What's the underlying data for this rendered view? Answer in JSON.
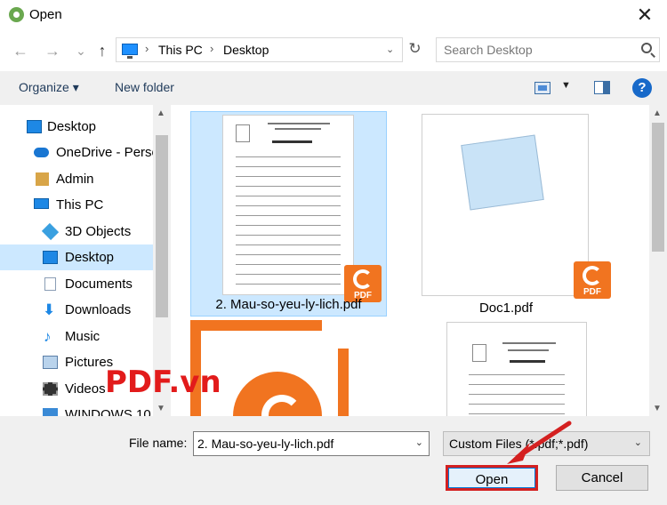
{
  "window": {
    "title": "Open",
    "close_glyph": "✕"
  },
  "nav_buttons": {
    "back": "←",
    "forward": "→",
    "recent": "⌄",
    "up": "↑"
  },
  "breadcrumb": {
    "items": [
      "This PC",
      "Desktop"
    ],
    "separator": "›",
    "refresh_glyph": "↻"
  },
  "search": {
    "placeholder": "Search Desktop"
  },
  "toolbar": {
    "organize": "Organize ▾",
    "new_folder": "New folder",
    "view_dropdown": "▼",
    "help": "?"
  },
  "nav_pane": {
    "items": [
      {
        "label": "Desktop",
        "icon": "desktop-icon",
        "color": "#1e88e5"
      },
      {
        "label": "OneDrive - Perso",
        "icon": "onedrive-icon",
        "color": "#1976d2"
      },
      {
        "label": "Admin",
        "icon": "user-folder-icon",
        "color": "#d8a548"
      },
      {
        "label": "This PC",
        "icon": "pc-icon",
        "color": "#1e88e5"
      },
      {
        "label": "3D Objects",
        "icon": "cube-icon",
        "color": "#3aa0e0"
      },
      {
        "label": "Desktop",
        "icon": "desktop-icon",
        "color": "#1e88e5"
      },
      {
        "label": "Documents",
        "icon": "documents-icon",
        "color": "#8a9db5"
      },
      {
        "label": "Downloads",
        "icon": "downloads-icon",
        "color": "#1e88e5"
      },
      {
        "label": "Music",
        "icon": "music-icon",
        "color": "#1e88e5"
      },
      {
        "label": "Pictures",
        "icon": "pictures-icon",
        "color": "#5b7fa8"
      },
      {
        "label": "Videos",
        "icon": "videos-icon",
        "color": "#333333"
      },
      {
        "label": "WINDOWS 10 (",
        "icon": "drive-icon",
        "color": "#3a8ad6"
      }
    ],
    "selected_index": 5
  },
  "files": [
    {
      "name": "2. Mau-so-yeu-ly-lich.pdf",
      "selected": true
    },
    {
      "name": "Doc1.pdf",
      "selected": false
    }
  ],
  "watermark": "PDF.vn",
  "pdf_badge_text": "PDF",
  "bottom": {
    "file_name_label": "File name:",
    "file_name_value": "2. Mau-so-yeu-ly-lich.pdf",
    "filter": "Custom Files (*.pdf;*.pdf)",
    "dropdown_glyph": "⌄",
    "open_button": "Open",
    "cancel_button": "Cancel"
  },
  "colors": {
    "accent": "#0078d7",
    "selection": "#cce8ff",
    "pdf_orange": "#f17420",
    "highlight_red": "#d42020"
  }
}
